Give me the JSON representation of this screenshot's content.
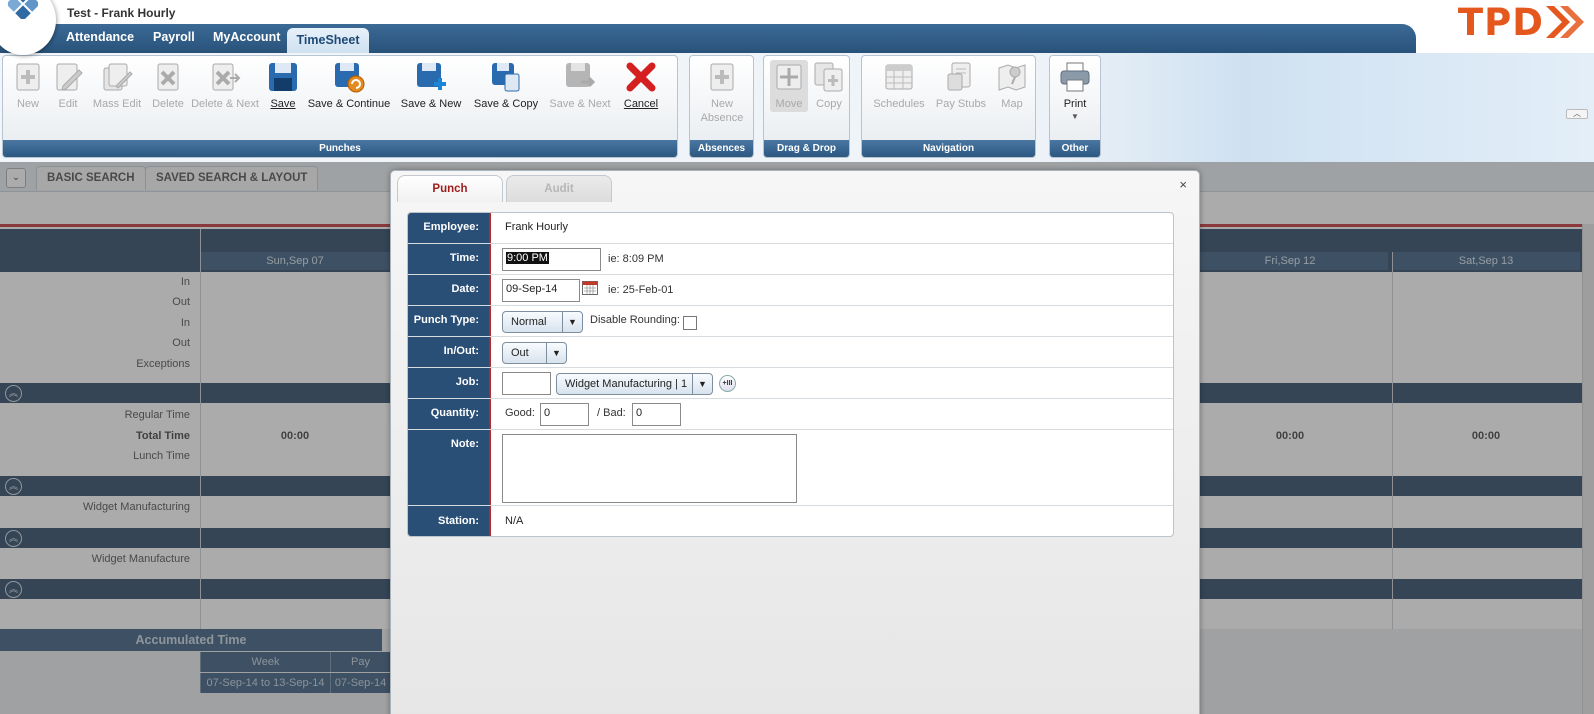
{
  "header": {
    "title": "Test - Frank Hourly",
    "brand": "TPD",
    "nav": [
      "Attendance",
      "Payroll",
      "MyAccount"
    ],
    "active_nav": "TimeSheet"
  },
  "ribbon": {
    "groups": {
      "punches": "Punches",
      "absences": "Absences",
      "dragdrop": "Drag & Drop",
      "navigation": "Navigation",
      "other": "Other"
    },
    "buttons": {
      "new": "New",
      "edit": "Edit",
      "mass_edit": "Mass Edit",
      "delete": "Delete",
      "delete_next": "Delete & Next",
      "save": "Save",
      "save_continue": "Save & Continue",
      "save_new": "Save & New",
      "save_copy": "Save & Copy",
      "save_next": "Save & Next",
      "cancel": "Cancel",
      "new_absence_1": "New",
      "new_absence_2": "Absence",
      "move": "Move",
      "copy": "Copy",
      "schedules": "Schedules",
      "pay_stubs": "Pay Stubs",
      "map": "Map",
      "print": "Print"
    }
  },
  "search": {
    "basic": "BASIC SEARCH",
    "saved": "SAVED SEARCH & LAYOUT"
  },
  "timesheet": {
    "days": [
      "Sun,Sep 07",
      "Fri,Sep 12",
      "Sat,Sep 13"
    ],
    "row_labels": [
      "In",
      "Out",
      "In",
      "Out",
      "Exceptions"
    ],
    "summary_labels": [
      "Regular Time",
      "Total Time",
      "Lunch Time"
    ],
    "totals": [
      "00:00",
      "00:00",
      "00:00"
    ],
    "job_1": "Widget Manufacturing",
    "job_2": "Widget Manufacture",
    "accumulated_title": "Accumulated Time",
    "accum_week": "Week",
    "accum_pay": "Pay",
    "accum_range_1": "07-Sep-14 to 13-Sep-14",
    "accum_range_2": "07-Sep-14"
  },
  "dialog": {
    "tab_punch": "Punch",
    "tab_audit": "Audit",
    "close": "×",
    "labels": {
      "employee": "Employee:",
      "time": "Time:",
      "date": "Date:",
      "punch_type": "Punch Type:",
      "in_out": "In/Out:",
      "job": "Job:",
      "quantity": "Quantity:",
      "note": "Note:",
      "station": "Station:"
    },
    "employee": "Frank Hourly",
    "time_value": "9:00 PM",
    "time_hint": "ie: 8:09 PM",
    "date_value": "09-Sep-14",
    "date_hint": "ie: 25-Feb-01",
    "punch_type": "Normal",
    "disable_rounding": "Disable Rounding:",
    "in_out": "Out",
    "job_code": "",
    "job_select": "Widget Manufacturing | 1",
    "good_label": "Good:",
    "good_value": "0",
    "bad_label": "/ Bad:",
    "bad_value": "0",
    "note": "",
    "station": "N/A"
  },
  "colors": {
    "nav_blue": "#28527a",
    "brand_orange": "#e4571d",
    "label_column": "#2a4f77",
    "accent_red": "#c0272d"
  }
}
